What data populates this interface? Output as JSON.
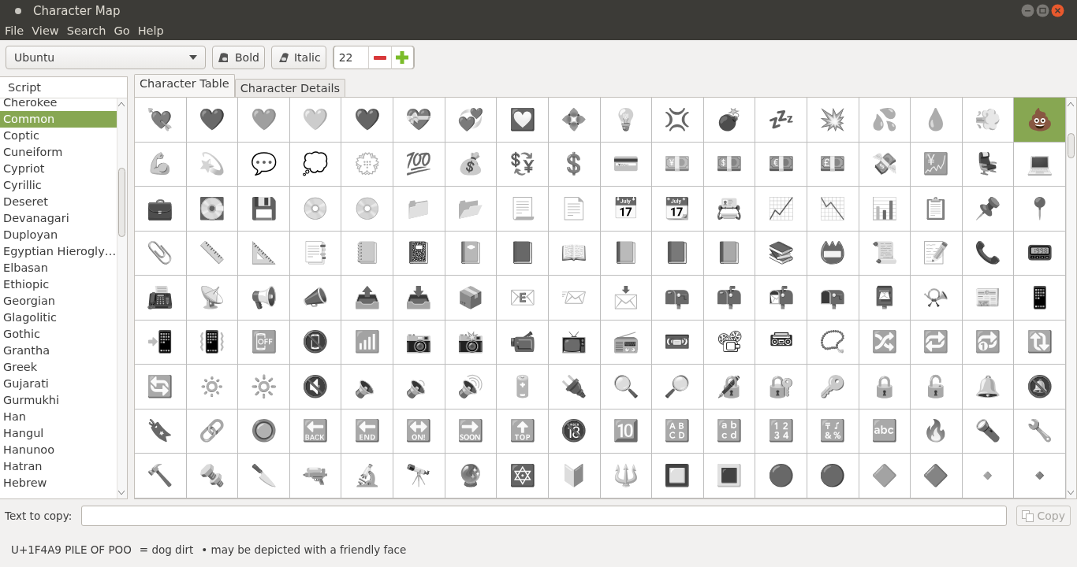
{
  "window": {
    "title": "Character Map"
  },
  "menu": [
    "File",
    "View",
    "Search",
    "Go",
    "Help"
  ],
  "toolbar": {
    "font": "Ubuntu",
    "bold": {
      "label": "Bold"
    },
    "italic": {
      "label": "Italic"
    },
    "size": "22"
  },
  "scripts": {
    "header": "Script",
    "items": [
      {
        "label": "Cherokee",
        "selected": false
      },
      {
        "label": "Common",
        "selected": true
      },
      {
        "label": "Coptic",
        "selected": false
      },
      {
        "label": "Cuneiform",
        "selected": false
      },
      {
        "label": "Cypriot",
        "selected": false
      },
      {
        "label": "Cyrillic",
        "selected": false
      },
      {
        "label": "Deseret",
        "selected": false
      },
      {
        "label": "Devanagari",
        "selected": false
      },
      {
        "label": "Duployan",
        "selected": false
      },
      {
        "label": "Egyptian Hierogly…",
        "selected": false
      },
      {
        "label": "Elbasan",
        "selected": false
      },
      {
        "label": "Ethiopic",
        "selected": false
      },
      {
        "label": "Georgian",
        "selected": false
      },
      {
        "label": "Glagolitic",
        "selected": false
      },
      {
        "label": "Gothic",
        "selected": false
      },
      {
        "label": "Grantha",
        "selected": false
      },
      {
        "label": "Greek",
        "selected": false
      },
      {
        "label": "Gujarati",
        "selected": false
      },
      {
        "label": "Gurmukhi",
        "selected": false
      },
      {
        "label": "Han",
        "selected": false
      },
      {
        "label": "Hangul",
        "selected": false
      },
      {
        "label": "Hanunoo",
        "selected": false
      },
      {
        "label": "Hatran",
        "selected": false
      },
      {
        "label": "Hebrew",
        "selected": false
      }
    ]
  },
  "tabs": [
    {
      "label": "Character Table",
      "selected": true
    },
    {
      "label": "Character Details",
      "selected": false
    }
  ],
  "table": {
    "rows": [
      {
        "cells": [
          {
            "char": "💘",
            "selected": false
          },
          {
            "char": "💙",
            "selected": false
          },
          {
            "char": "💚",
            "selected": false
          },
          {
            "char": "💛",
            "selected": false
          },
          {
            "char": "💜",
            "selected": false
          },
          {
            "char": "💝",
            "selected": false
          },
          {
            "char": "💞",
            "selected": false
          },
          {
            "char": "💟",
            "selected": false
          },
          {
            "char": "💠",
            "selected": false
          },
          {
            "char": "💡",
            "selected": false
          },
          {
            "char": "💢",
            "selected": false
          },
          {
            "char": "💣",
            "selected": false
          },
          {
            "char": "💤",
            "selected": false
          },
          {
            "char": "💥",
            "selected": false
          },
          {
            "char": "💦",
            "selected": false
          },
          {
            "char": "💧",
            "selected": false
          },
          {
            "char": "💨",
            "selected": false
          },
          {
            "char": "💩",
            "selected": true
          }
        ]
      },
      {
        "cells": [
          {
            "char": "💪",
            "selected": false
          },
          {
            "char": "💫",
            "selected": false
          },
          {
            "char": "💬",
            "selected": false
          },
          {
            "char": "💭",
            "selected": false
          },
          {
            "char": "💮",
            "selected": false
          },
          {
            "char": "💯",
            "selected": false
          },
          {
            "char": "💰",
            "selected": false
          },
          {
            "char": "💱",
            "selected": false
          },
          {
            "char": "💲",
            "selected": false
          },
          {
            "char": "💳",
            "selected": false
          },
          {
            "char": "💴",
            "selected": false
          },
          {
            "char": "💵",
            "selected": false
          },
          {
            "char": "💶",
            "selected": false
          },
          {
            "char": "💷",
            "selected": false
          },
          {
            "char": "💸",
            "selected": false
          },
          {
            "char": "💹",
            "selected": false
          },
          {
            "char": "💺",
            "selected": false
          },
          {
            "char": "💻",
            "selected": false
          }
        ]
      },
      {
        "cells": [
          {
            "char": "💼",
            "selected": false
          },
          {
            "char": "💽",
            "selected": false
          },
          {
            "char": "💾",
            "selected": false
          },
          {
            "char": "💿",
            "selected": false
          },
          {
            "char": "📀",
            "selected": false
          },
          {
            "char": "📁",
            "selected": false
          },
          {
            "char": "📂",
            "selected": false
          },
          {
            "char": "📃",
            "selected": false
          },
          {
            "char": "📄",
            "selected": false
          },
          {
            "char": "📅",
            "selected": false
          },
          {
            "char": "📆",
            "selected": false
          },
          {
            "char": "📇",
            "selected": false
          },
          {
            "char": "📈",
            "selected": false
          },
          {
            "char": "📉",
            "selected": false
          },
          {
            "char": "📊",
            "selected": false
          },
          {
            "char": "📋",
            "selected": false
          },
          {
            "char": "📌",
            "selected": false
          },
          {
            "char": "📍",
            "selected": false
          }
        ]
      },
      {
        "cells": [
          {
            "char": "📎",
            "selected": false
          },
          {
            "char": "📏",
            "selected": false
          },
          {
            "char": "📐",
            "selected": false
          },
          {
            "char": "📑",
            "selected": false
          },
          {
            "char": "📒",
            "selected": false
          },
          {
            "char": "📓",
            "selected": false
          },
          {
            "char": "📔",
            "selected": false
          },
          {
            "char": "📕",
            "selected": false
          },
          {
            "char": "📖",
            "selected": false
          },
          {
            "char": "📗",
            "selected": false
          },
          {
            "char": "📘",
            "selected": false
          },
          {
            "char": "📙",
            "selected": false
          },
          {
            "char": "📚",
            "selected": false
          },
          {
            "char": "📛",
            "selected": false
          },
          {
            "char": "📜",
            "selected": false
          },
          {
            "char": "📝",
            "selected": false
          },
          {
            "char": "📞",
            "selected": false
          },
          {
            "char": "📟",
            "selected": false
          }
        ]
      },
      {
        "cells": [
          {
            "char": "📠",
            "selected": false
          },
          {
            "char": "📡",
            "selected": false
          },
          {
            "char": "📢",
            "selected": false
          },
          {
            "char": "📣",
            "selected": false
          },
          {
            "char": "📤",
            "selected": false
          },
          {
            "char": "📥",
            "selected": false
          },
          {
            "char": "📦",
            "selected": false
          },
          {
            "char": "📧",
            "selected": false
          },
          {
            "char": "📨",
            "selected": false
          },
          {
            "char": "📩",
            "selected": false
          },
          {
            "char": "📪",
            "selected": false
          },
          {
            "char": "📫",
            "selected": false
          },
          {
            "char": "📬",
            "selected": false
          },
          {
            "char": "📭",
            "selected": false
          },
          {
            "char": "📮",
            "selected": false
          },
          {
            "char": "📯",
            "selected": false
          },
          {
            "char": "📰",
            "selected": false
          },
          {
            "char": "📱",
            "selected": false
          }
        ]
      },
      {
        "cells": [
          {
            "char": "📲",
            "selected": false
          },
          {
            "char": "📳",
            "selected": false
          },
          {
            "char": "📴",
            "selected": false
          },
          {
            "char": "📵",
            "selected": false
          },
          {
            "char": "📶",
            "selected": false
          },
          {
            "char": "📷",
            "selected": false
          },
          {
            "char": "📸",
            "selected": false
          },
          {
            "char": "📹",
            "selected": false
          },
          {
            "char": "📺",
            "selected": false
          },
          {
            "char": "📻",
            "selected": false
          },
          {
            "char": "📼",
            "selected": false
          },
          {
            "char": "📽",
            "selected": false
          },
          {
            "char": "📾",
            "selected": false
          },
          {
            "char": "📿",
            "selected": false
          },
          {
            "char": "🔀",
            "selected": false
          },
          {
            "char": "🔁",
            "selected": false
          },
          {
            "char": "🔂",
            "selected": false
          },
          {
            "char": "🔃",
            "selected": false
          }
        ]
      },
      {
        "cells": [
          {
            "char": "🔄",
            "selected": false
          },
          {
            "char": "🔅",
            "selected": false
          },
          {
            "char": "🔆",
            "selected": false
          },
          {
            "char": "🔇",
            "selected": false
          },
          {
            "char": "🔈",
            "selected": false
          },
          {
            "char": "🔉",
            "selected": false
          },
          {
            "char": "🔊",
            "selected": false
          },
          {
            "char": "🔋",
            "selected": false
          },
          {
            "char": "🔌",
            "selected": false
          },
          {
            "char": "🔍",
            "selected": false
          },
          {
            "char": "🔎",
            "selected": false
          },
          {
            "char": "🔏",
            "selected": false
          },
          {
            "char": "🔐",
            "selected": false
          },
          {
            "char": "🔑",
            "selected": false
          },
          {
            "char": "🔒",
            "selected": false
          },
          {
            "char": "🔓",
            "selected": false
          },
          {
            "char": "🔔",
            "selected": false
          },
          {
            "char": "🔕",
            "selected": false
          }
        ]
      },
      {
        "cells": [
          {
            "char": "🔖",
            "selected": false
          },
          {
            "char": "🔗",
            "selected": false
          },
          {
            "char": "🔘",
            "selected": false
          },
          {
            "char": "🔙",
            "selected": false
          },
          {
            "char": "🔚",
            "selected": false
          },
          {
            "char": "🔛",
            "selected": false
          },
          {
            "char": "🔜",
            "selected": false
          },
          {
            "char": "🔝",
            "selected": false
          },
          {
            "char": "🔞",
            "selected": false
          },
          {
            "char": "🔟",
            "selected": false
          },
          {
            "char": "🔠",
            "selected": false
          },
          {
            "char": "🔡",
            "selected": false
          },
          {
            "char": "🔢",
            "selected": false
          },
          {
            "char": "🔣",
            "selected": false
          },
          {
            "char": "🔤",
            "selected": false
          },
          {
            "char": "🔥",
            "selected": false
          },
          {
            "char": "🔦",
            "selected": false
          },
          {
            "char": "🔧",
            "selected": false
          }
        ]
      },
      {
        "cells": [
          {
            "char": "🔨",
            "selected": false
          },
          {
            "char": "🔩",
            "selected": false
          },
          {
            "char": "🔪",
            "selected": false
          },
          {
            "char": "🔫",
            "selected": false
          },
          {
            "char": "🔬",
            "selected": false
          },
          {
            "char": "🔭",
            "selected": false
          },
          {
            "char": "🔮",
            "selected": false
          },
          {
            "char": "🔯",
            "selected": false
          },
          {
            "char": "🔰",
            "selected": false
          },
          {
            "char": "🔱",
            "selected": false
          },
          {
            "char": "🔲",
            "selected": false
          },
          {
            "char": "🔳",
            "selected": false
          },
          {
            "char": "🔴",
            "selected": false
          },
          {
            "char": "🔵",
            "selected": false
          },
          {
            "char": "🔶",
            "selected": false
          },
          {
            "char": "🔷",
            "selected": false
          },
          {
            "char": "🔸",
            "selected": false
          },
          {
            "char": "🔹",
            "selected": false
          }
        ]
      }
    ]
  },
  "copy": {
    "label": "Text to copy:",
    "button": {
      "label": "Copy",
      "disabled": true
    }
  },
  "status": {
    "name": "U+1F4A9 PILE OF POO",
    "alias": "= dog dirt",
    "note": "• may be depicted with a friendly face"
  }
}
